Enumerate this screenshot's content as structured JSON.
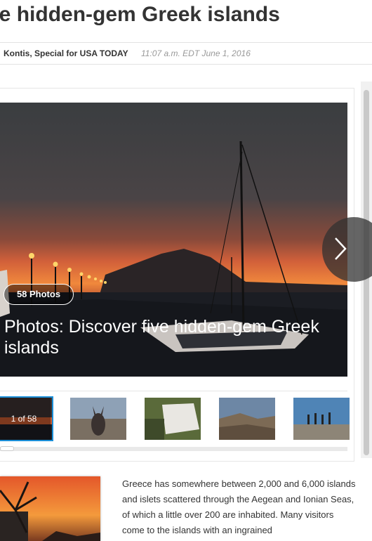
{
  "article": {
    "headline": "ve hidden-gem Greek islands",
    "author": "Kontis, Special for USA TODAY",
    "timestamp": "11:07 a.m. EDT June 1, 2016",
    "body": "Greece has somewhere between 2,000 and 6,000 islands and islets scattered through the Aegean and Ionian Seas, of which a little over 200 are inhabited. Many visitors come to the islands with an ingrained"
  },
  "gallery": {
    "photo_count": "58 Photos",
    "caption": "Photos: Discover five hidden-gem Greek islands",
    "current_label": "1 of 58",
    "next_icon": "chevron-right-icon"
  },
  "colors": {
    "accent": "#1b8fd8",
    "headline": "#333333",
    "timestamp": "#999999"
  }
}
